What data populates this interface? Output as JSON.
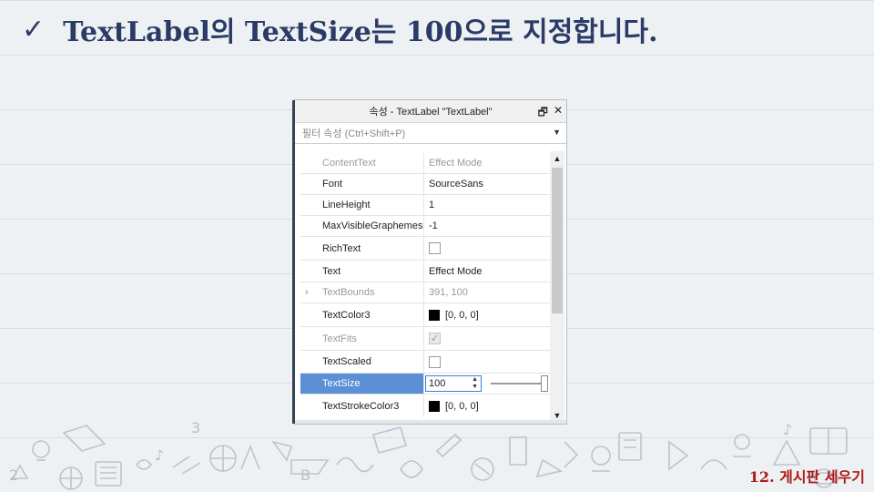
{
  "slide": {
    "title": "TextLabel의 TextSize는 100으로 지정합니다.",
    "footer": "12. 게시판 세우기"
  },
  "panel": {
    "title": "속성 - TextLabel \"TextLabel\"",
    "filter_placeholder": "필터 속성 (Ctrl+Shift+P)",
    "rows": [
      {
        "name": "ContentText",
        "value": "Effect Mode"
      },
      {
        "name": "Font",
        "value": "SourceSans"
      },
      {
        "name": "LineHeight",
        "value": "1"
      },
      {
        "name": "MaxVisibleGraphemes",
        "value": "-1"
      },
      {
        "name": "RichText",
        "value": ""
      },
      {
        "name": "Text",
        "value": "Effect Mode"
      },
      {
        "name": "TextBounds",
        "value": "391, 100"
      },
      {
        "name": "TextColor3",
        "value": "[0, 0, 0]"
      },
      {
        "name": "TextFits",
        "value": ""
      },
      {
        "name": "TextScaled",
        "value": ""
      },
      {
        "name": "TextSize",
        "value": "100"
      },
      {
        "name": "TextStrokeColor3",
        "value": "[0, 0, 0]"
      }
    ]
  },
  "colors": {
    "title": "#2a3b66",
    "footer": "#b01818",
    "selection": "#5b8fd6"
  }
}
